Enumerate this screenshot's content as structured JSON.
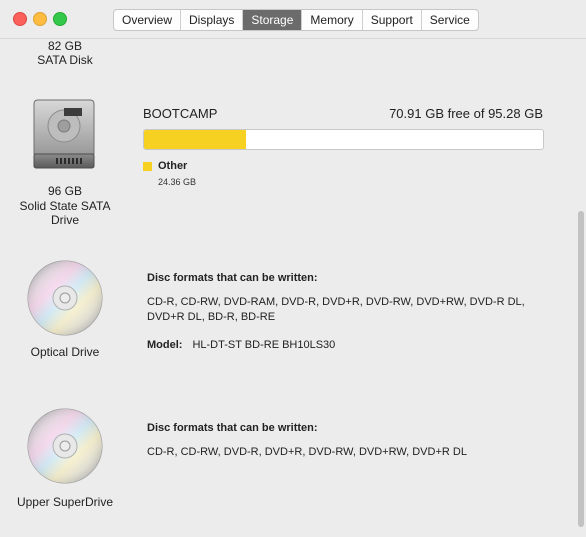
{
  "window": {
    "tabs": [
      {
        "label": "Overview"
      },
      {
        "label": "Displays"
      },
      {
        "label": "Storage"
      },
      {
        "label": "Memory"
      },
      {
        "label": "Support"
      },
      {
        "label": "Service"
      }
    ],
    "active_tab": "Storage"
  },
  "drives": [
    {
      "size": "82 GB",
      "type": "SATA Disk"
    },
    {
      "size": "96 GB",
      "type_line1": "Solid State SATA",
      "type_line2": "Drive",
      "volume": {
        "name": "BOOTCAMP",
        "free_text": "70.91 GB free of 95.28 GB",
        "used_fraction": 0.2557,
        "legend": [
          {
            "label": "Other",
            "size": "24.36 GB",
            "color": "#f7d122"
          }
        ]
      }
    },
    {
      "name": "Optical Drive",
      "formats_heading": "Disc formats that can be written:",
      "formats_line1": "CD-R, CD-RW, DVD-RAM, DVD-R, DVD+R, DVD-RW, DVD+RW, DVD-R DL,",
      "formats_line2": "DVD+R DL, BD-R, BD-RE",
      "model_label": "Model:",
      "model_value": "HL-DT-ST BD-RE BH10LS30"
    },
    {
      "name": "Upper SuperDrive",
      "formats_heading": "Disc formats that can be written:",
      "formats_line1": "CD-R, CD-RW, DVD-R, DVD+R, DVD-RW, DVD+RW, DVD+R DL"
    }
  ]
}
